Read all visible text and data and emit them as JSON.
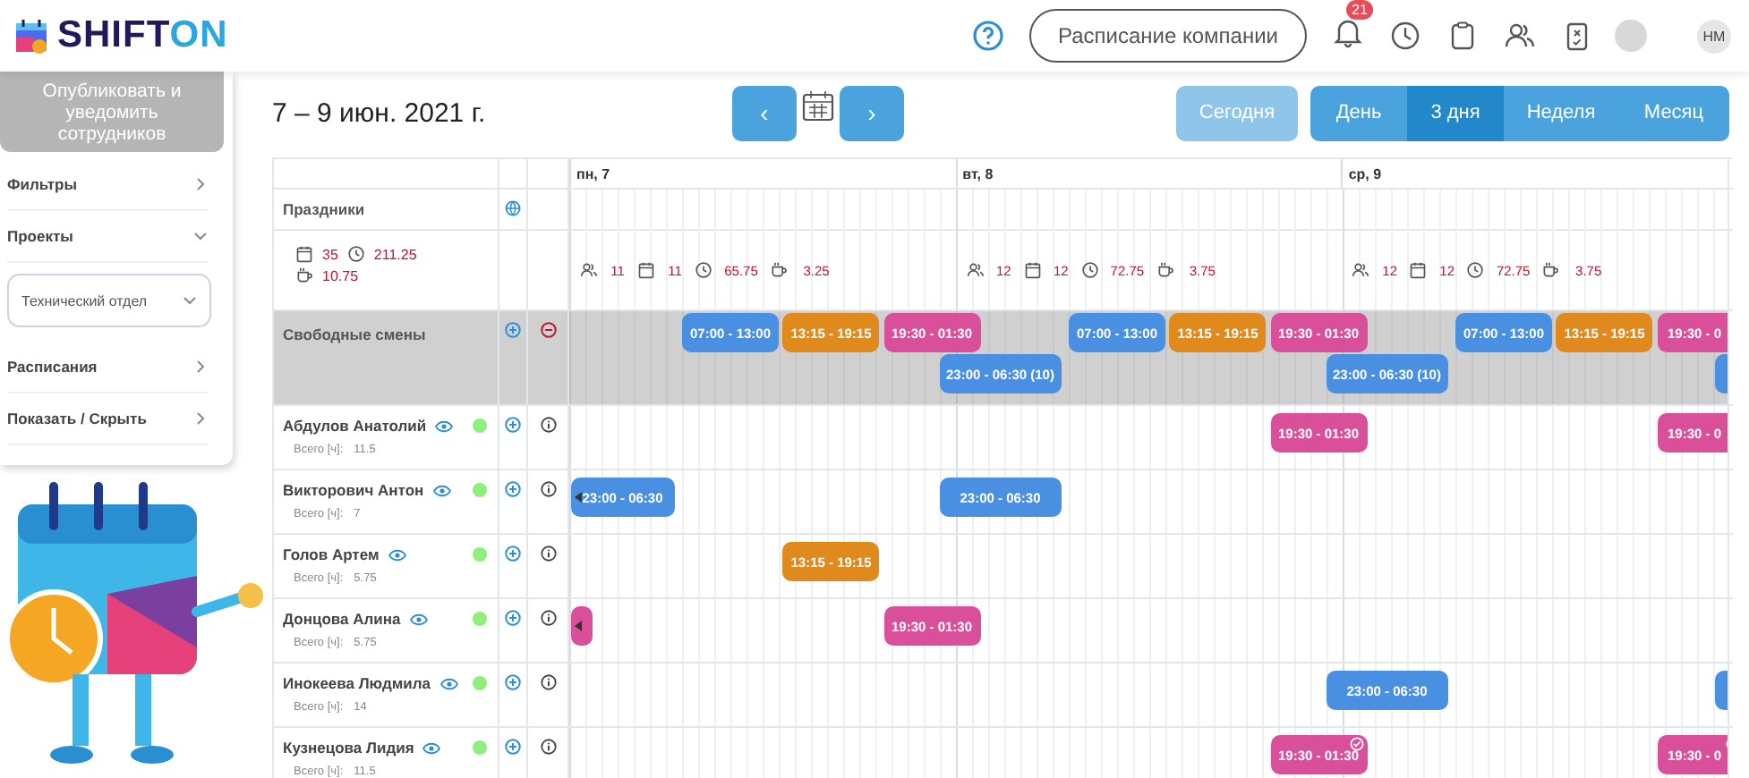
{
  "header": {
    "logo_text": [
      "SHIFT",
      "ON"
    ],
    "company_schedule_button": "Расписание компании",
    "notifications_badge": "21",
    "avatar": "НМ"
  },
  "sidebar": {
    "publish_button": "Опубликовать и уведомить сотрудников",
    "items": [
      {
        "kind": "link",
        "label": "Фильтры",
        "expanded": false
      },
      {
        "kind": "link",
        "label": "Проекты",
        "expanded": true
      },
      {
        "kind": "select",
        "value": "Технический отдел"
      },
      {
        "kind": "link",
        "label": "Расписания",
        "expanded": false
      },
      {
        "kind": "link",
        "label": "Показать / Скрыть",
        "expanded": false
      }
    ]
  },
  "toolbar": {
    "date_range": "7 – 9 июн. 2021 г.",
    "prev_button": "‹",
    "next_button": "›",
    "today_button": "Сегодня",
    "views": [
      {
        "label": "День",
        "selected": false
      },
      {
        "label": "3 дня",
        "selected": true
      },
      {
        "label": "Неделя",
        "selected": false
      },
      {
        "label": "Месяц",
        "selected": false
      }
    ]
  },
  "schedule": {
    "days": [
      "пн, 7",
      "вт, 8",
      "ср, 9"
    ],
    "holidays_label": "Праздники",
    "summary": {
      "days": "35",
      "hours": "211.25",
      "breaks": "10.75"
    },
    "day_stats": [
      {
        "people": "11",
        "days": "11",
        "hours": "65.75",
        "breaks": "3.25"
      },
      {
        "people": "12",
        "days": "12",
        "hours": "72.75",
        "breaks": "3.75"
      },
      {
        "people": "12",
        "days": "12",
        "hours": "72.75",
        "breaks": "3.75"
      }
    ],
    "free_shifts": {
      "label": "Свободные смены",
      "lanes": [
        [
          {
            "shifts": [
              {
                "kind": "shift",
                "label": "07:00 - 13:00",
                "color": "#4a90e2"
              },
              {
                "kind": "shift",
                "label": "13:15 - 19:15",
                "color": "#e08a1e"
              },
              {
                "kind": "shift",
                "label": "19:30 - 01:30",
                "color": "#d94f9a"
              }
            ]
          },
          {
            "shifts": [
              {
                "kind": "shift",
                "label": "07:00 - 13:00",
                "color": "#4a90e2"
              },
              {
                "kind": "shift",
                "label": "13:15 - 19:15",
                "color": "#e08a1e"
              },
              {
                "kind": "shift",
                "label": "19:30 - 01:30",
                "color": "#d94f9a"
              }
            ]
          },
          {
            "shifts": [
              {
                "kind": "shift",
                "label": "07:00 - 13:00",
                "color": "#4a90e2"
              },
              {
                "kind": "shift",
                "label": "13:15 - 19:15",
                "color": "#e08a1e"
              },
              {
                "kind": "cut",
                "label": "19:30 - 0",
                "color": "#d94f9a"
              }
            ]
          }
        ],
        [
          {
            "shifts": [
              {
                "kind": "shift",
                "label": "23:00 - 06:30  (10)",
                "color": "#4a90e2"
              }
            ]
          },
          {
            "shifts": [
              {
                "kind": "shift",
                "label": "23:00 - 06:30  (10)",
                "color": "#4a90e2"
              }
            ]
          },
          {
            "shifts": [
              {
                "kind": "stub_end",
                "color": "#4a90e2"
              }
            ]
          }
        ]
      ]
    },
    "employees": [
      {
        "name": "Абдулов Анатолий",
        "total_label": "Всего [ч]:",
        "total": "11.5",
        "online": true,
        "day_2": [
          {
            "kind": "shift",
            "label": "19:30 - 01:30",
            "color": "#d94f9a",
            "confirmed": false
          }
        ],
        "day_3": [
          {
            "kind": "cut",
            "label": "19:30 - 0",
            "color": "#d94f9a",
            "confirmed": false
          }
        ]
      },
      {
        "name": "Викторович Антон",
        "total_label": "Всего [ч]:",
        "total": "7",
        "online": true,
        "day_1": [
          {
            "kind": "continued",
            "label": "23:00 - 06:30",
            "color": "#4a90e2",
            "confirmed": false
          },
          {
            "kind": "shift",
            "label": "23:00 - 06:30",
            "color": "#4a90e2",
            "confirmed": false
          }
        ]
      },
      {
        "name": "Голов Артем",
        "total_label": "Всего [ч]:",
        "total": "5.75",
        "online": true,
        "day_1": [
          {
            "kind": "shift",
            "label": "13:15 - 19:15",
            "color": "#e08a1e",
            "confirmed": false
          }
        ]
      },
      {
        "name": "Донцова Алина",
        "total_label": "Всего [ч]:",
        "total": "5.75",
        "online": true,
        "day_1": [
          {
            "kind": "stub_start",
            "color": "#d94f9a",
            "confirmed": false
          },
          {
            "kind": "shift",
            "label": "19:30 - 01:30",
            "color": "#d94f9a",
            "confirmed": false
          }
        ]
      },
      {
        "name": "Инокеева Людмила",
        "total_label": "Всего [ч]:",
        "total": "14",
        "online": true,
        "day_2": [
          {
            "kind": "shift",
            "label": "23:00 - 06:30",
            "color": "#4a90e2",
            "confirmed": false
          }
        ],
        "day_3": [
          {
            "kind": "stub_end",
            "color": "#4a90e2",
            "confirmed": false
          }
        ]
      },
      {
        "name": "Кузнецова Лидия",
        "total_label": "Всего [ч]:",
        "total": "11.5",
        "online": true,
        "day_2": [
          {
            "kind": "shift",
            "label": "19:30 - 01:30",
            "color": "#d94f9a",
            "confirmed": true
          }
        ],
        "day_3": [
          {
            "kind": "cut",
            "label": "19:30 - 0",
            "color": "#d94f9a",
            "confirmed": true
          }
        ]
      }
    ]
  }
}
